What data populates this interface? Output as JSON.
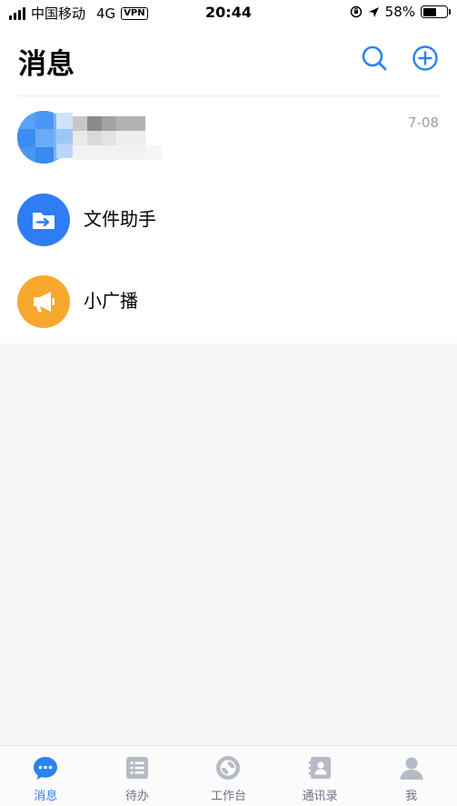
{
  "status_bar": {
    "carrier": "中国移动",
    "network": "4G",
    "vpn": "VPN",
    "time": "20:44",
    "battery": "58%",
    "battery_level": 0.58
  },
  "header": {
    "title": "消息",
    "search_icon": "search-icon",
    "add_icon": "add-circle-icon"
  },
  "conversations": [
    {
      "title": "",
      "time": "7-08",
      "avatar": "blurred-avatar"
    },
    {
      "title": "文件助手",
      "time": "",
      "avatar": "folder-transfer-icon"
    },
    {
      "title": "小广播",
      "time": "",
      "avatar": "megaphone-icon"
    }
  ],
  "tabbar": {
    "tabs": [
      {
        "label": "消息",
        "icon": "chat-bubble-icon",
        "active": true
      },
      {
        "label": "待办",
        "icon": "todo-list-icon",
        "active": false
      },
      {
        "label": "工作台",
        "icon": "workbench-icon",
        "active": false
      },
      {
        "label": "通讯录",
        "icon": "contacts-icon",
        "active": false
      },
      {
        "label": "我",
        "icon": "profile-icon",
        "active": false
      }
    ]
  },
  "colors": {
    "accent": "#2b82f0",
    "file_assistant": "#2f7df5",
    "broadcast": "#f8a82c",
    "inactive_tab": "#b5bbc6"
  }
}
